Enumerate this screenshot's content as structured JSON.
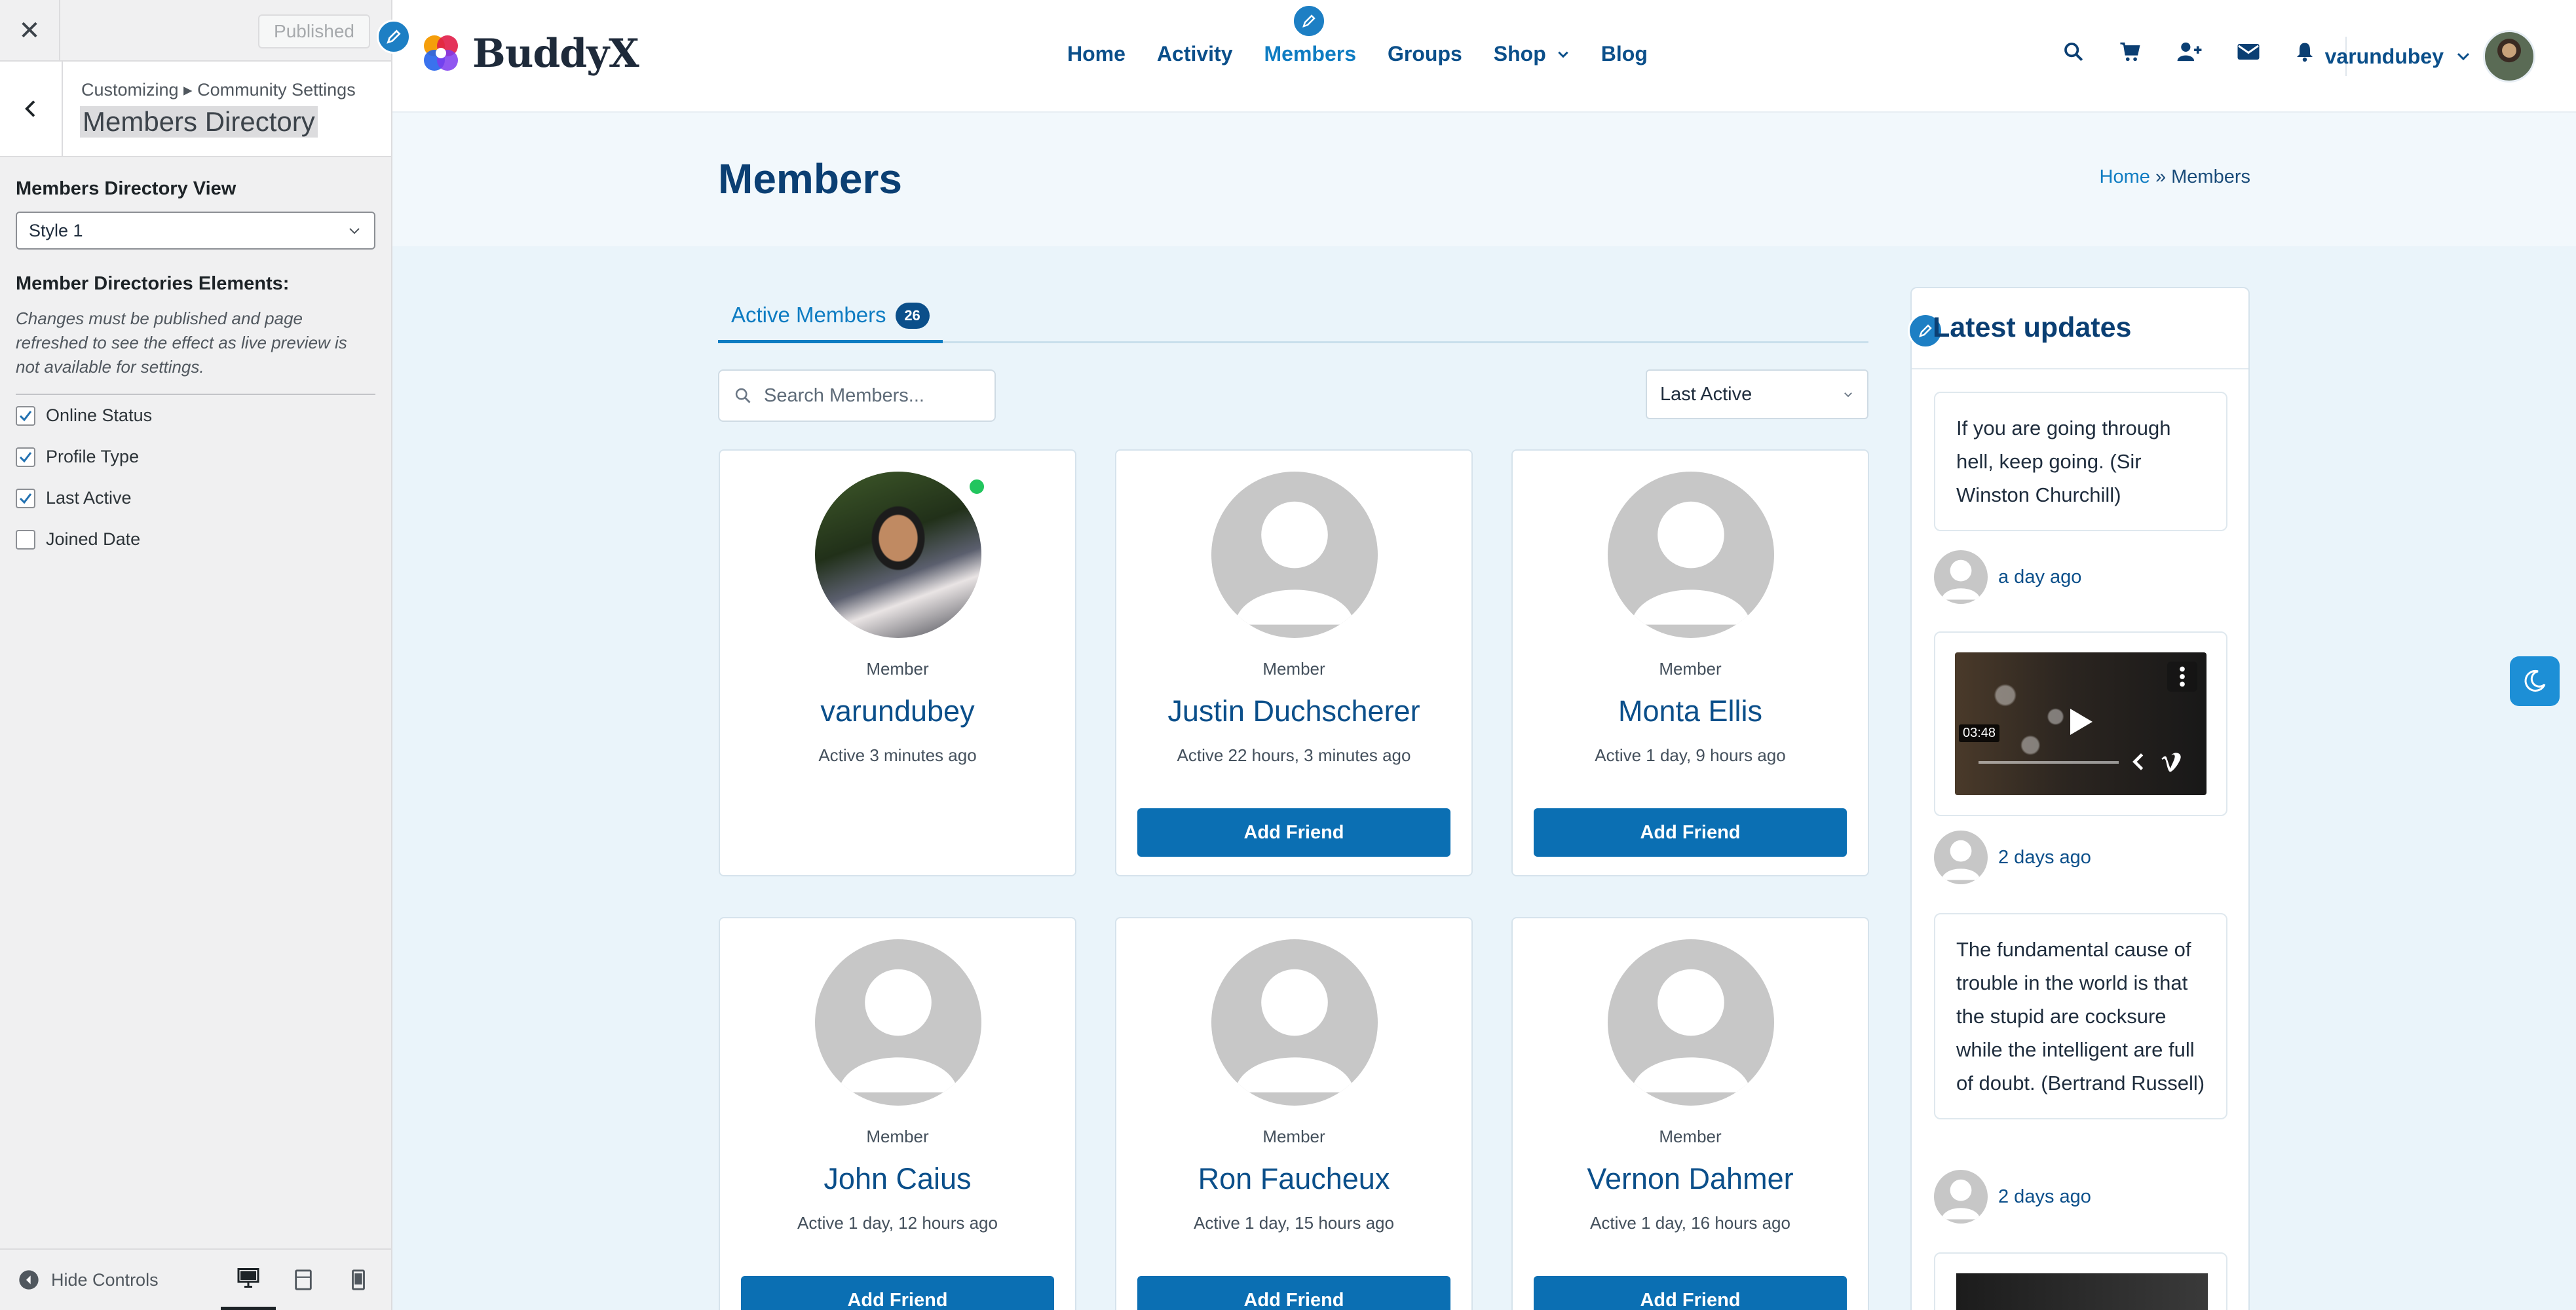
{
  "customizer": {
    "published_label": "Published",
    "breadcrumb": "Customizing ▸ Community Settings",
    "section_title": "Members Directory",
    "view_label": "Members Directory View",
    "view_value": "Style 1",
    "elements_label": "Member Directories Elements:",
    "description": "Changes must be published and page refreshed to see the effect as live preview is not available for settings.",
    "checkboxes": [
      {
        "label": "Online Status",
        "checked": true
      },
      {
        "label": "Profile Type",
        "checked": true
      },
      {
        "label": "Last Active",
        "checked": true
      },
      {
        "label": "Joined Date",
        "checked": false
      }
    ],
    "hide_controls": "Hide Controls"
  },
  "header": {
    "logo_text": "BuddyX",
    "nav": [
      "Home",
      "Activity",
      "Members",
      "Groups",
      "Shop",
      "Blog"
    ],
    "active_nav": "Members",
    "username": "varundubey"
  },
  "page": {
    "title": "Members",
    "breadcrumb_home": "Home",
    "breadcrumb_sep": "»",
    "breadcrumb_current": "Members"
  },
  "directory": {
    "tab_label": "Active Members",
    "tab_count": "26",
    "search_placeholder": "Search Members...",
    "sort_value": "Last Active",
    "members": [
      {
        "type": "Member",
        "name": "varundubey",
        "active": "Active 3 minutes ago",
        "button": ""
      },
      {
        "type": "Member",
        "name": "Justin Duchscherer",
        "active": "Active 22 hours, 3 minutes ago",
        "button": "Add Friend"
      },
      {
        "type": "Member",
        "name": "Monta Ellis",
        "active": "Active 1 day, 9 hours ago",
        "button": "Add Friend"
      },
      {
        "type": "Member",
        "name": "John Caius",
        "active": "Active 1 day, 12 hours ago",
        "button": "Add Friend"
      },
      {
        "type": "Member",
        "name": "Ron Faucheux",
        "active": "Active 1 day, 15 hours ago",
        "button": "Add Friend"
      },
      {
        "type": "Member",
        "name": "Vernon Dahmer",
        "active": "Active 1 day, 16 hours ago",
        "button": "Add Friend"
      }
    ]
  },
  "widget": {
    "title": "Latest updates",
    "updates": [
      {
        "text": "If you are going through hell, keep going. (Sir Winston Churchill)",
        "time": "a day ago"
      },
      {
        "video_duration": "03:48",
        "time": "2 days ago"
      },
      {
        "text": "The fundamental cause of trouble in the world is that the stupid are cocksure while the intelligent are full of doubt. (Bertrand Russell)",
        "time": "2 days ago"
      }
    ]
  }
}
